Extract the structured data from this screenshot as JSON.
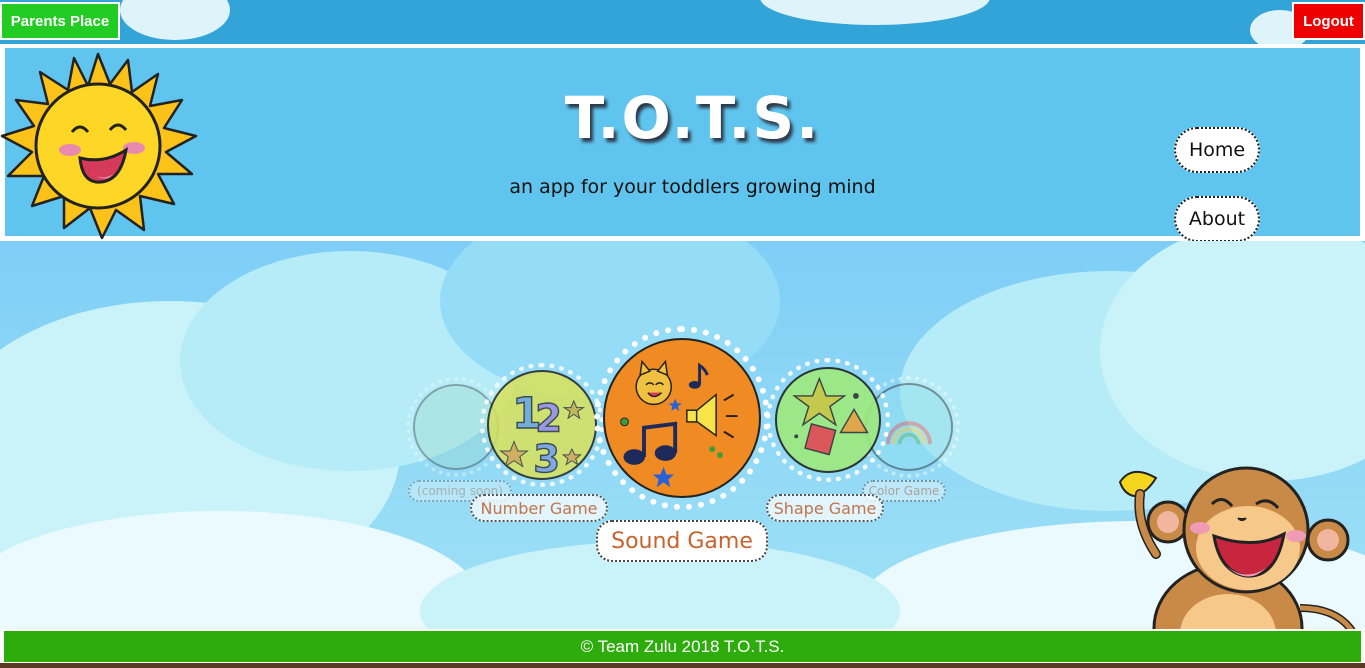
{
  "topbar": {
    "parents_label": "Parents Place",
    "logout_label": "Logout"
  },
  "header": {
    "title": "T.O.T.S.",
    "tagline": "an app for your toddlers growing mind",
    "nav": [
      {
        "label": "Home"
      },
      {
        "label": "About"
      }
    ]
  },
  "games": [
    {
      "label": "(coming soon)",
      "icon": "coming-soon-icon",
      "state": "faded"
    },
    {
      "label": "Number Game",
      "icon": "numbers-123-icon",
      "state": "side"
    },
    {
      "label": "Sound Game",
      "icon": "sound-cat-music-icon",
      "state": "selected"
    },
    {
      "label": "Shape Game",
      "icon": "shapes-star-triangle-icon",
      "state": "side"
    },
    {
      "label": "Color Game",
      "icon": "rainbow-icon",
      "state": "faded"
    }
  ],
  "footer": {
    "text": "© Team Zulu 2018 T.O.T.S."
  },
  "colors": {
    "parents_button": "#22cc22",
    "logout_button": "#ee0000",
    "header_bg": "#5fc5ef",
    "footer_bg": "#2dac0c",
    "label_text": "#c9622c"
  }
}
